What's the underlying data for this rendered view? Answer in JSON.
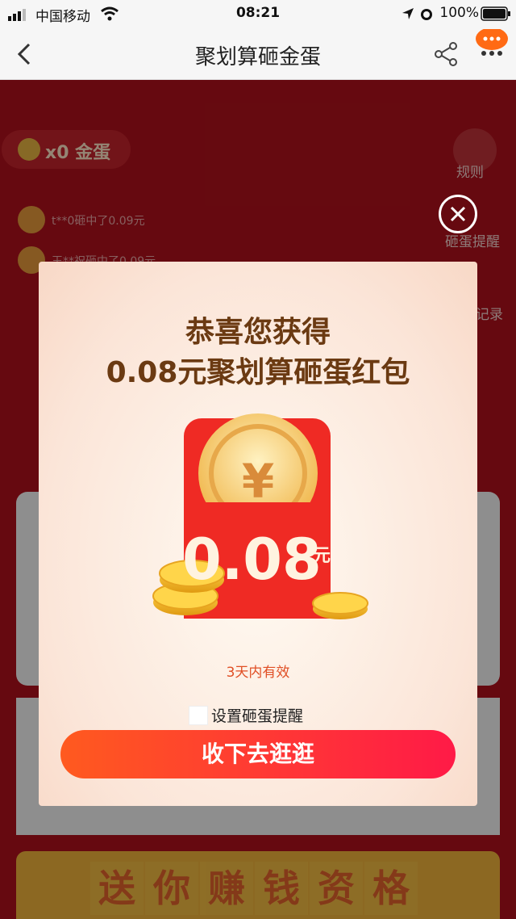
{
  "status_bar": {
    "carrier": "中国移动",
    "time": "08:21",
    "battery": "100%"
  },
  "nav": {
    "title": "聚划算砸金蛋"
  },
  "background": {
    "egg_count": "x0 金蛋",
    "rules_label": "规则",
    "remind_label": "砸蛋提醒",
    "record_label": "记录",
    "winners": [
      "t**0砸中了0.09元",
      "王**祝砸中了0.09元"
    ],
    "slogan": [
      "送",
      "你",
      "赚",
      "钱",
      "资",
      "格"
    ]
  },
  "modal": {
    "title_line1": "恭喜您获得",
    "title_line2": "0.08元聚划算砸蛋红包",
    "amount": "0.08",
    "unit": "元",
    "validity": "3天内有效",
    "remind_checkbox_label": "设置砸蛋提醒",
    "confirm_button": "收下去逛逛"
  },
  "colors": {
    "accent_red": "#ff1a47",
    "title_brown": "#6b3a12",
    "envelope_red": "#ef2a24"
  }
}
